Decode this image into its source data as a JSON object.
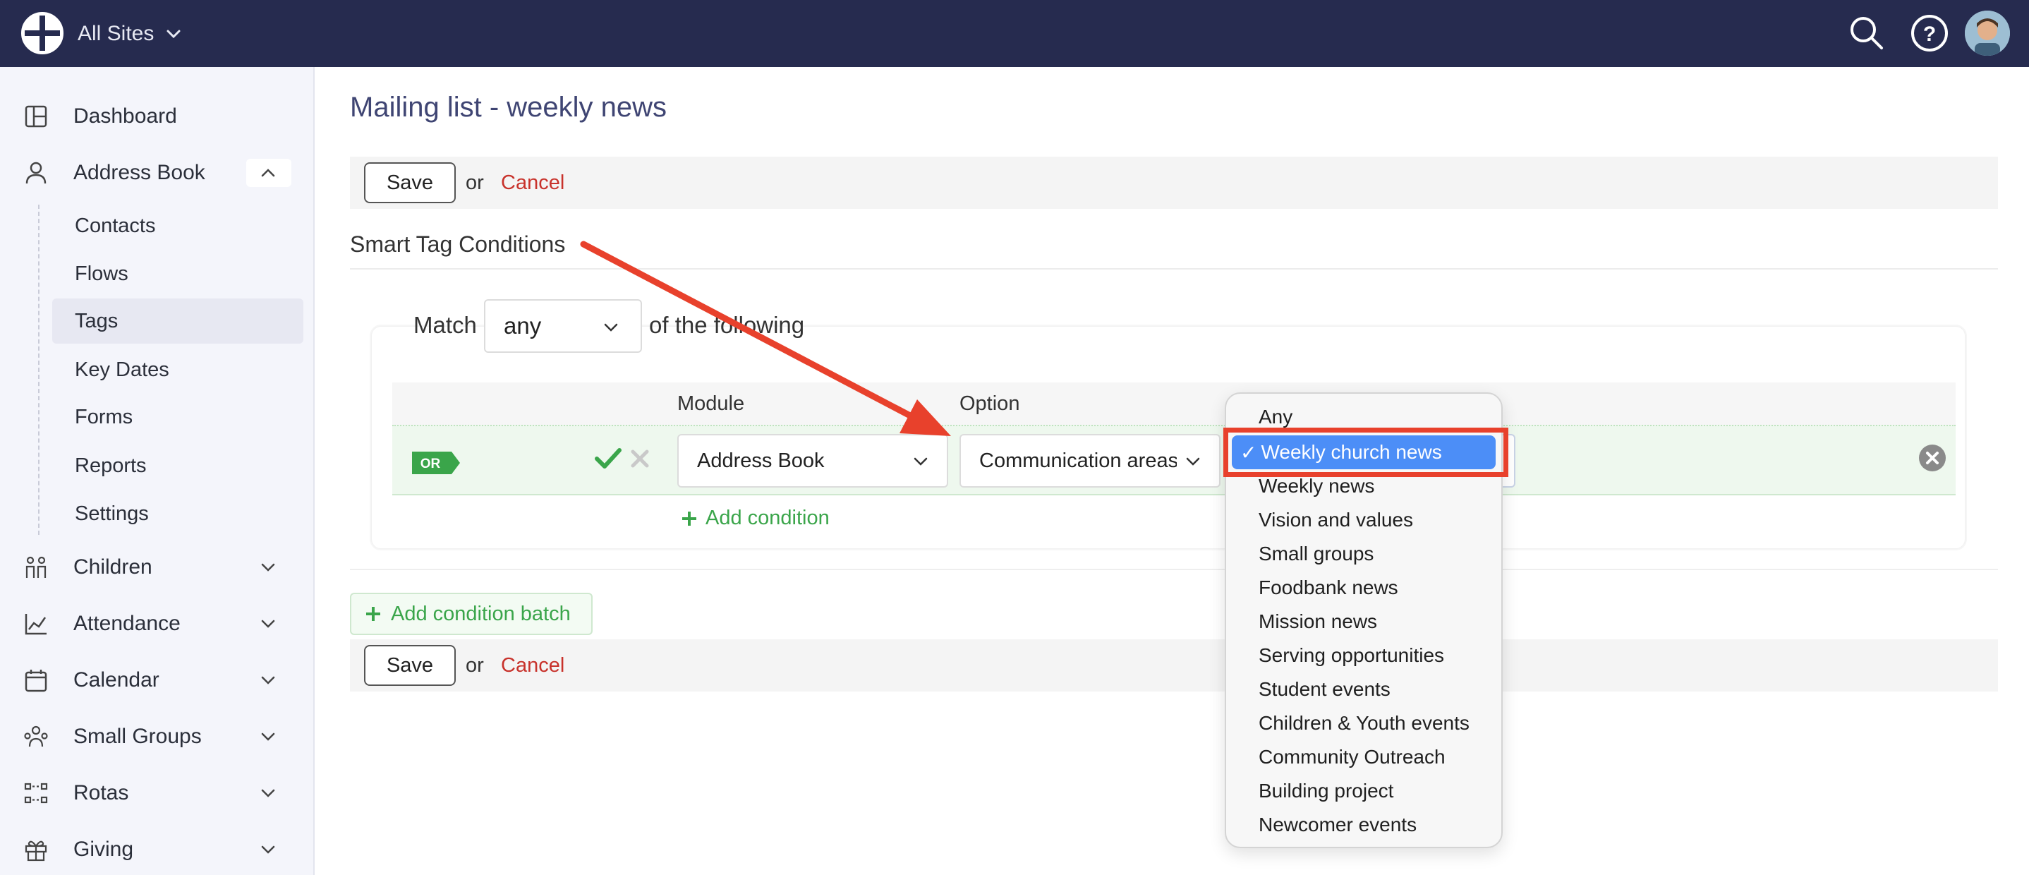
{
  "topbar": {
    "site_switcher": "All Sites",
    "icons": [
      "logo-icon",
      "search-icon",
      "help-icon",
      "avatar"
    ]
  },
  "sidebar": {
    "items": [
      {
        "label": "Dashboard",
        "icon": "dashboard-icon"
      },
      {
        "label": "Address Book",
        "icon": "user-icon",
        "expanded": true
      },
      {
        "label": "Children",
        "icon": "children-icon"
      },
      {
        "label": "Attendance",
        "icon": "chart-icon"
      },
      {
        "label": "Calendar",
        "icon": "calendar-icon"
      },
      {
        "label": "Small Groups",
        "icon": "group-icon"
      },
      {
        "label": "Rotas",
        "icon": "rota-icon"
      },
      {
        "label": "Giving",
        "icon": "gift-icon"
      }
    ],
    "address_book_sub": [
      "Contacts",
      "Flows",
      "Tags",
      "Key Dates",
      "Forms",
      "Reports",
      "Settings"
    ],
    "active_sub": "Tags"
  },
  "page": {
    "title": "Mailing list - weekly news",
    "save_label": "Save",
    "or_text": "or",
    "cancel_label": "Cancel",
    "section_title": "Smart Tag Conditions",
    "match_prefix": "Match",
    "match_value": "any",
    "match_suffix": "of the following",
    "col_module": "Module",
    "col_option": "Option",
    "or_badge": "OR",
    "module_value": "Address Book",
    "option_value": "Communication areas",
    "add_condition": "Add condition",
    "add_condition_batch": "Add condition batch"
  },
  "dropdown": {
    "selected": "Weekly church news",
    "check_mark": "✓",
    "options": [
      "Any",
      "Weekly church news",
      "Weekly news",
      "Vision and values",
      "Small groups",
      "Foodbank news",
      "Mission news",
      "Serving opportunities",
      "Student events",
      "Children & Youth events",
      "Community Outreach",
      "Building project",
      "Newcomer events"
    ]
  },
  "colors": {
    "topbar": "#262b4f",
    "accent_green": "#3aa54a",
    "cancel_red": "#c8322b",
    "annotation_red": "#e8412c",
    "selection_blue": "#4c8ef7"
  }
}
